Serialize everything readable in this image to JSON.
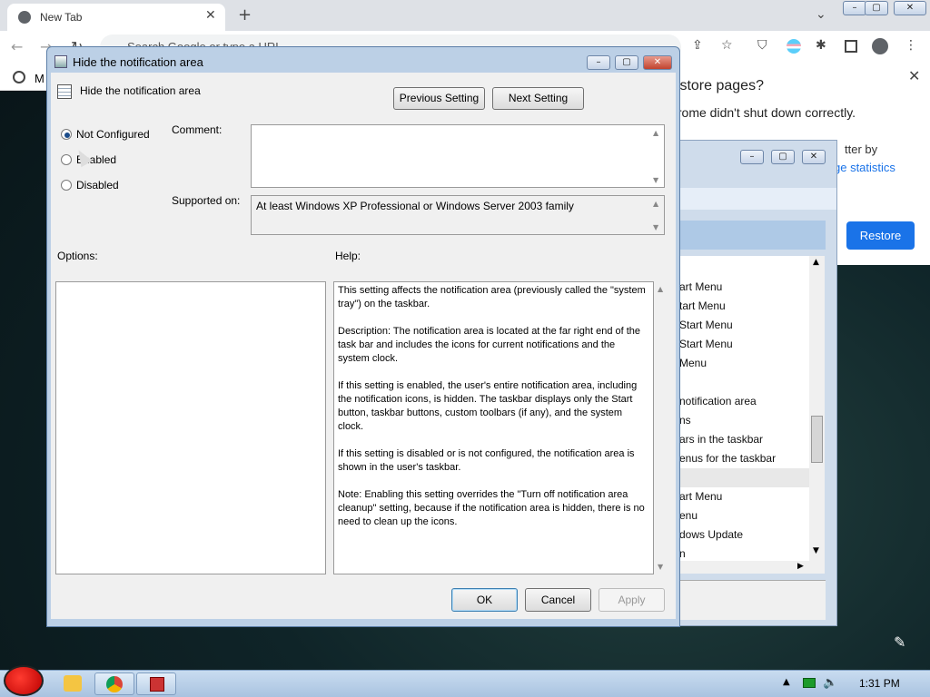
{
  "chrome": {
    "tab_title": "New Tab",
    "address_placeholder": "Search Google or type a URL",
    "bookmark_label": "M",
    "restore_panel": {
      "title": "Restore pages?",
      "message": "Chrome didn't shut down correctly.",
      "partial_1": "tter by",
      "partial_2": "ge statistics",
      "restore_button": "Restore"
    }
  },
  "bg_window": {
    "list_items": [
      "art Menu",
      "tart Menu",
      "Start Menu",
      "Start Menu",
      "Menu",
      "",
      "notification area",
      "ns",
      "ars in the taskbar",
      "enus for the taskbar",
      "",
      "art Menu",
      "enu",
      "dows Update",
      "n"
    ]
  },
  "dialog": {
    "title": "Hide the notification area",
    "setting_name": "Hide the notification area",
    "prev_button": "Previous Setting",
    "next_button": "Next Setting",
    "radio_not_configured": "Not Configured",
    "radio_enabled": "Enabled",
    "radio_disabled": "Disabled",
    "selected_option": "Not Configured",
    "comment_label": "Comment:",
    "supported_label": "Supported on:",
    "supported_value": "At least Windows XP Professional or Windows Server 2003 family",
    "options_label": "Options:",
    "help_label": "Help:",
    "help_text": "This setting affects the notification area (previously called the \"system tray\") on the taskbar.\n\nDescription: The notification area is located at the far right end of the task bar and includes the icons for current notifications and the system clock.\n\nIf this setting is enabled, the user's entire notification area, including the notification icons, is hidden. The taskbar displays only the Start button, taskbar buttons, custom toolbars (if any), and the system clock.\n\nIf this setting is disabled or is not configured, the notification area is shown in the user's taskbar.\n\nNote: Enabling this setting overrides the \"Turn off notification area cleanup\" setting, because if the notification area is hidden, there is no need to clean up the icons.",
    "ok_button": "OK",
    "cancel_button": "Cancel",
    "apply_button": "Apply"
  },
  "taskbar": {
    "clock": "1:31 PM"
  }
}
